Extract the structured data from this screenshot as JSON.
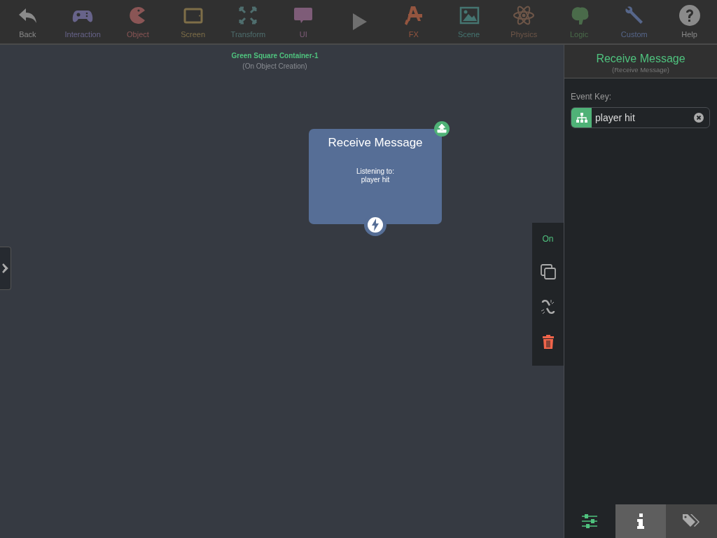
{
  "toolbar": [
    {
      "kind": "tool",
      "label": "Back",
      "color": "#8a8a8a"
    },
    {
      "kind": "tool",
      "label": "Interaction",
      "color": "#67638a"
    },
    {
      "kind": "tool",
      "label": "Object",
      "color": "#8a5555"
    },
    {
      "kind": "tool",
      "label": "Screen",
      "color": "#7e6e48"
    },
    {
      "kind": "tool",
      "label": "Transform",
      "color": "#4f6e6e"
    },
    {
      "kind": "tool",
      "label": "UI",
      "color": "#7e5c78"
    },
    {
      "kind": "play",
      "color": "#6f6f6f"
    },
    {
      "kind": "tool",
      "label": "FX",
      "color": "#94553f"
    },
    {
      "kind": "tool",
      "label": "Scene",
      "color": "#457571"
    },
    {
      "kind": "tool",
      "label": "Physics",
      "color": "#6e5648"
    },
    {
      "kind": "tool",
      "label": "Logic",
      "color": "#4a6b4a"
    },
    {
      "kind": "tool",
      "label": "Custom",
      "color": "#56668a"
    },
    {
      "kind": "tool",
      "label": "Help",
      "color": "#8a8a8a"
    }
  ],
  "canvas": {
    "object_name": "Green Square Container-1",
    "trigger": "(On Object Creation)",
    "node": {
      "title": "Receive Message",
      "body": "Listening to:\nplayer hit"
    }
  },
  "actions": {
    "toggle": {
      "label": "On",
      "on": true
    }
  },
  "inspector": {
    "title": "Receive Message",
    "subtitle": "(Receive Message)",
    "fields": [
      {
        "label": "Event Key:",
        "value": "player hit"
      }
    ],
    "tabs": [
      {
        "selected": true
      },
      {
        "selected": false
      },
      {
        "selected": false
      }
    ]
  }
}
